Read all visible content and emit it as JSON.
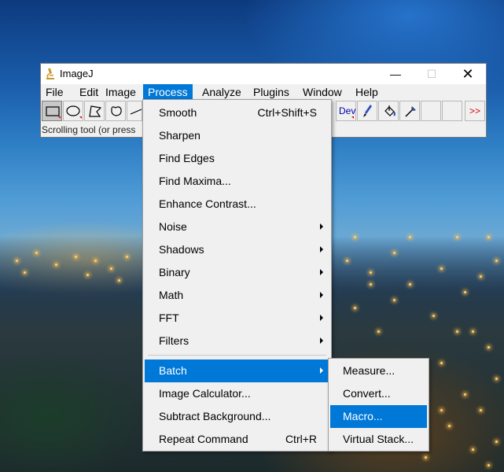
{
  "window": {
    "title": "ImageJ",
    "status_text": "Scrolling tool (or press",
    "minimize_glyph": "—",
    "maximize_glyph": "☐",
    "close_glyph": "✕"
  },
  "menubar": {
    "items": [
      "File",
      "Edit",
      "Image",
      "Process",
      "Analyze",
      "Plugins",
      "Window",
      "Help"
    ],
    "active": "Process"
  },
  "toolbar": {
    "tools": [
      "rectangle-tool",
      "oval-tool",
      "polygon-tool",
      "freehand-tool",
      "line-tool"
    ],
    "dev_label": "Dev",
    "more_label": ">>",
    "right_tools": [
      "brush-tool",
      "flood-fill-tool",
      "pick-color-tool"
    ]
  },
  "process_menu": {
    "items": [
      {
        "label": "Smooth",
        "shortcut": "Ctrl+Shift+S",
        "submenu": false
      },
      {
        "label": "Sharpen",
        "shortcut": "",
        "submenu": false
      },
      {
        "label": "Find Edges",
        "shortcut": "",
        "submenu": false
      },
      {
        "label": "Find Maxima...",
        "shortcut": "",
        "submenu": false
      },
      {
        "label": "Enhance Contrast...",
        "shortcut": "",
        "submenu": false
      },
      {
        "label": "Noise",
        "shortcut": "",
        "submenu": true
      },
      {
        "label": "Shadows",
        "shortcut": "",
        "submenu": true
      },
      {
        "label": "Binary",
        "shortcut": "",
        "submenu": true
      },
      {
        "label": "Math",
        "shortcut": "",
        "submenu": true
      },
      {
        "label": "FFT",
        "shortcut": "",
        "submenu": true
      },
      {
        "label": "Filters",
        "shortcut": "",
        "submenu": true
      },
      {
        "label": "Batch",
        "shortcut": "",
        "submenu": true,
        "highlighted": true
      },
      {
        "label": "Image Calculator...",
        "shortcut": "",
        "submenu": false
      },
      {
        "label": "Subtract Background...",
        "shortcut": "",
        "submenu": false
      },
      {
        "label": "Repeat Command",
        "shortcut": "Ctrl+R",
        "submenu": false
      }
    ]
  },
  "batch_submenu": {
    "items": [
      {
        "label": "Measure...",
        "highlighted": false
      },
      {
        "label": "Convert...",
        "highlighted": false
      },
      {
        "label": "Macro...",
        "highlighted": true
      },
      {
        "label": "Virtual Stack...",
        "highlighted": false
      }
    ]
  },
  "colors": {
    "highlight": "#0078d7",
    "menu_bg": "#f0f0f0"
  }
}
